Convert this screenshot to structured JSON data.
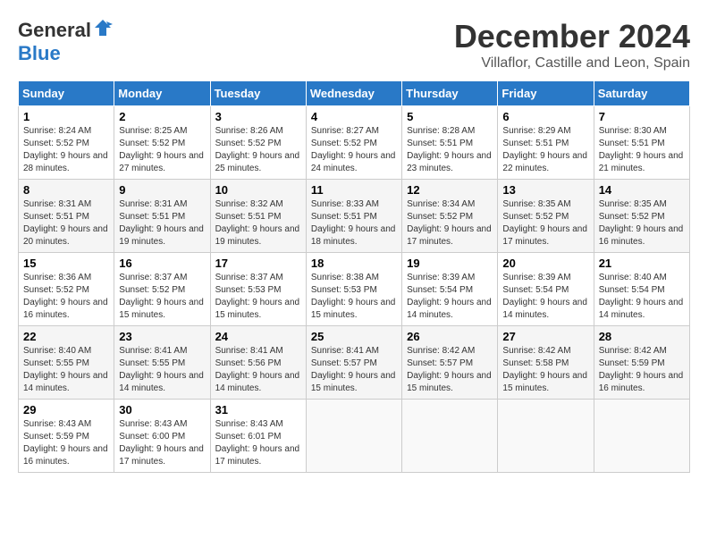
{
  "logo": {
    "general": "General",
    "blue": "Blue"
  },
  "title": "December 2024",
  "location": "Villaflor, Castille and Leon, Spain",
  "days_of_week": [
    "Sunday",
    "Monday",
    "Tuesday",
    "Wednesday",
    "Thursday",
    "Friday",
    "Saturday"
  ],
  "weeks": [
    [
      {
        "day": "1",
        "sunrise": "8:24 AM",
        "sunset": "5:52 PM",
        "daylight": "9 hours and 28 minutes."
      },
      {
        "day": "2",
        "sunrise": "8:25 AM",
        "sunset": "5:52 PM",
        "daylight": "9 hours and 27 minutes."
      },
      {
        "day": "3",
        "sunrise": "8:26 AM",
        "sunset": "5:52 PM",
        "daylight": "9 hours and 25 minutes."
      },
      {
        "day": "4",
        "sunrise": "8:27 AM",
        "sunset": "5:52 PM",
        "daylight": "9 hours and 24 minutes."
      },
      {
        "day": "5",
        "sunrise": "8:28 AM",
        "sunset": "5:51 PM",
        "daylight": "9 hours and 23 minutes."
      },
      {
        "day": "6",
        "sunrise": "8:29 AM",
        "sunset": "5:51 PM",
        "daylight": "9 hours and 22 minutes."
      },
      {
        "day": "7",
        "sunrise": "8:30 AM",
        "sunset": "5:51 PM",
        "daylight": "9 hours and 21 minutes."
      }
    ],
    [
      {
        "day": "8",
        "sunrise": "8:31 AM",
        "sunset": "5:51 PM",
        "daylight": "9 hours and 20 minutes."
      },
      {
        "day": "9",
        "sunrise": "8:31 AM",
        "sunset": "5:51 PM",
        "daylight": "9 hours and 19 minutes."
      },
      {
        "day": "10",
        "sunrise": "8:32 AM",
        "sunset": "5:51 PM",
        "daylight": "9 hours and 19 minutes."
      },
      {
        "day": "11",
        "sunrise": "8:33 AM",
        "sunset": "5:51 PM",
        "daylight": "9 hours and 18 minutes."
      },
      {
        "day": "12",
        "sunrise": "8:34 AM",
        "sunset": "5:52 PM",
        "daylight": "9 hours and 17 minutes."
      },
      {
        "day": "13",
        "sunrise": "8:35 AM",
        "sunset": "5:52 PM",
        "daylight": "9 hours and 17 minutes."
      },
      {
        "day": "14",
        "sunrise": "8:35 AM",
        "sunset": "5:52 PM",
        "daylight": "9 hours and 16 minutes."
      }
    ],
    [
      {
        "day": "15",
        "sunrise": "8:36 AM",
        "sunset": "5:52 PM",
        "daylight": "9 hours and 16 minutes."
      },
      {
        "day": "16",
        "sunrise": "8:37 AM",
        "sunset": "5:52 PM",
        "daylight": "9 hours and 15 minutes."
      },
      {
        "day": "17",
        "sunrise": "8:37 AM",
        "sunset": "5:53 PM",
        "daylight": "9 hours and 15 minutes."
      },
      {
        "day": "18",
        "sunrise": "8:38 AM",
        "sunset": "5:53 PM",
        "daylight": "9 hours and 15 minutes."
      },
      {
        "day": "19",
        "sunrise": "8:39 AM",
        "sunset": "5:54 PM",
        "daylight": "9 hours and 14 minutes."
      },
      {
        "day": "20",
        "sunrise": "8:39 AM",
        "sunset": "5:54 PM",
        "daylight": "9 hours and 14 minutes."
      },
      {
        "day": "21",
        "sunrise": "8:40 AM",
        "sunset": "5:54 PM",
        "daylight": "9 hours and 14 minutes."
      }
    ],
    [
      {
        "day": "22",
        "sunrise": "8:40 AM",
        "sunset": "5:55 PM",
        "daylight": "9 hours and 14 minutes."
      },
      {
        "day": "23",
        "sunrise": "8:41 AM",
        "sunset": "5:55 PM",
        "daylight": "9 hours and 14 minutes."
      },
      {
        "day": "24",
        "sunrise": "8:41 AM",
        "sunset": "5:56 PM",
        "daylight": "9 hours and 14 minutes."
      },
      {
        "day": "25",
        "sunrise": "8:41 AM",
        "sunset": "5:57 PM",
        "daylight": "9 hours and 15 minutes."
      },
      {
        "day": "26",
        "sunrise": "8:42 AM",
        "sunset": "5:57 PM",
        "daylight": "9 hours and 15 minutes."
      },
      {
        "day": "27",
        "sunrise": "8:42 AM",
        "sunset": "5:58 PM",
        "daylight": "9 hours and 15 minutes."
      },
      {
        "day": "28",
        "sunrise": "8:42 AM",
        "sunset": "5:59 PM",
        "daylight": "9 hours and 16 minutes."
      }
    ],
    [
      {
        "day": "29",
        "sunrise": "8:43 AM",
        "sunset": "5:59 PM",
        "daylight": "9 hours and 16 minutes."
      },
      {
        "day": "30",
        "sunrise": "8:43 AM",
        "sunset": "6:00 PM",
        "daylight": "9 hours and 17 minutes."
      },
      {
        "day": "31",
        "sunrise": "8:43 AM",
        "sunset": "6:01 PM",
        "daylight": "9 hours and 17 minutes."
      },
      null,
      null,
      null,
      null
    ]
  ]
}
